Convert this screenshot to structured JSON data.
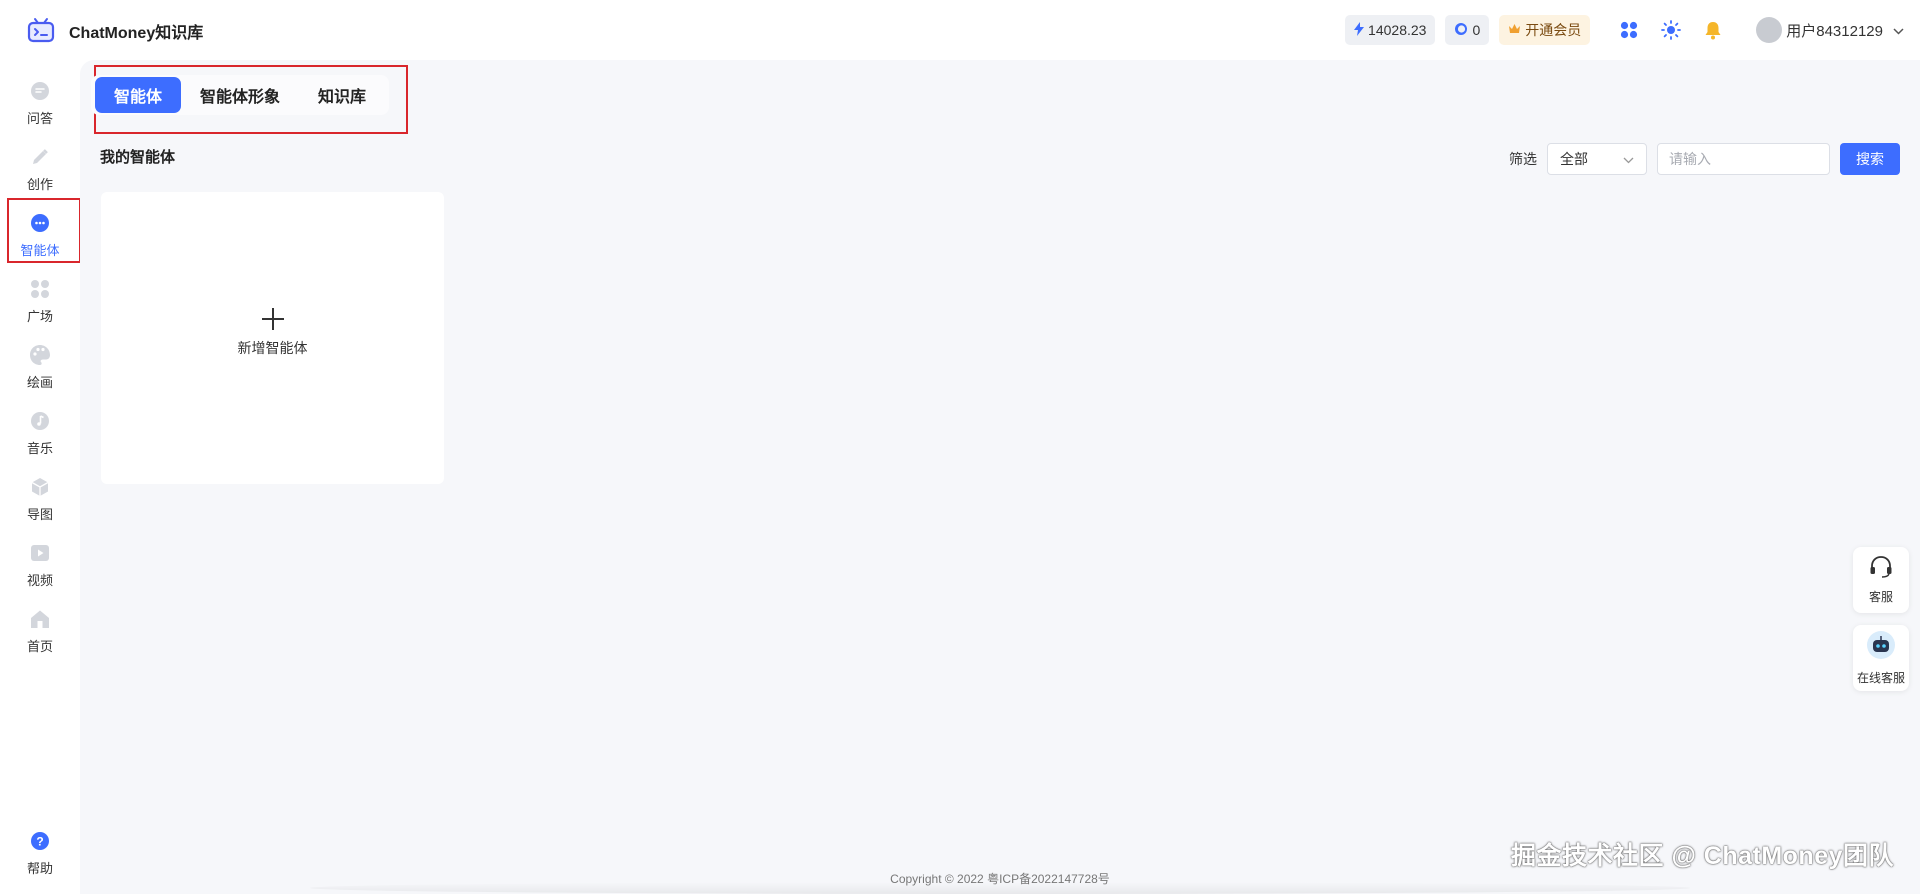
{
  "app": {
    "title": "ChatMoney知识库",
    "logo_icon": "robot-tv-icon"
  },
  "header": {
    "points": "14028.23",
    "coins": "0",
    "vip_label": "开通会员",
    "username": "用户84312129",
    "icons": [
      "apps-grid-icon",
      "sun-icon",
      "bell-icon"
    ]
  },
  "sidebar": {
    "items": [
      {
        "label": "问答",
        "icon": "chat-bubble-icon"
      },
      {
        "label": "创作",
        "icon": "pencil-icon"
      },
      {
        "label": "智能体",
        "icon": "agent-bubble-icon"
      },
      {
        "label": "广场",
        "icon": "grid-dots-icon"
      },
      {
        "label": "绘画",
        "icon": "palette-icon"
      },
      {
        "label": "音乐",
        "icon": "music-note-icon"
      },
      {
        "label": "导图",
        "icon": "cube-icon"
      },
      {
        "label": "视频",
        "icon": "play-icon"
      },
      {
        "label": "首页",
        "icon": "home-icon"
      }
    ],
    "active_index": 2,
    "help_label": "帮助"
  },
  "main": {
    "tabs": [
      {
        "label": "智能体",
        "active": true
      },
      {
        "label": "智能体形象",
        "active": false
      },
      {
        "label": "知识库",
        "active": false
      }
    ],
    "section_title": "我的智能体",
    "filter": {
      "label": "筛选",
      "select_value": "全部",
      "input_placeholder": "请输入",
      "search_label": "搜索"
    },
    "add_card_label": "新增智能体"
  },
  "footer": {
    "copyright": "Copyright © 2022 粤ICP备2022147728号"
  },
  "watermark": "掘金技术社区 @ ChatMoney团队",
  "float_buttons": [
    {
      "label": "客服",
      "icon": "headset-icon"
    },
    {
      "label": "在线客服",
      "icon": "robot-avatar-icon"
    }
  ],
  "colors": {
    "accent": "#3d6dff",
    "highlight_box": "#d9262c",
    "background": "#f6f7fa"
  }
}
